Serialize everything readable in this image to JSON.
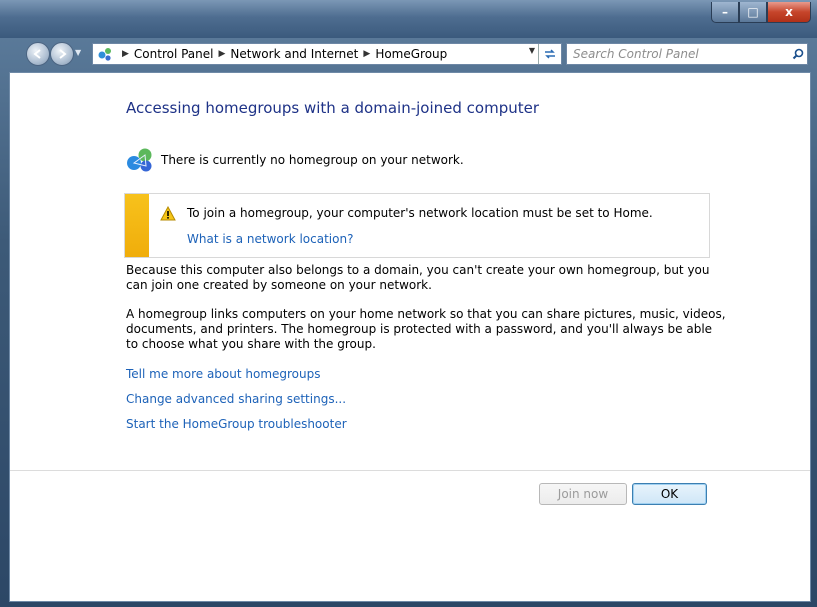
{
  "titlebar": {
    "minimize": "–",
    "maximize": "□",
    "close": "x"
  },
  "navbar": {
    "breadcrumbs": [
      "Control Panel",
      "Network and Internet",
      "HomeGroup"
    ],
    "search_placeholder": "Search Control Panel"
  },
  "main": {
    "heading": "Accessing homegroups with a domain-joined computer",
    "status_text": "There is currently no homegroup on your network.",
    "warning": {
      "text": "To join a homegroup, your computer's network location must be set to Home.",
      "link": "What is a network location?"
    },
    "paragraph1": "Because this computer also belongs to a domain, you can't create your own homegroup, but you can join one created by someone on your network.",
    "paragraph2": "A homegroup links computers on your home network so that you can share pictures, music, videos, documents, and printers. The homegroup is protected with a password, and you'll always be able to choose what you share with the group.",
    "links": [
      "Tell me more about homegroups",
      "Change advanced sharing settings...",
      "Start the HomeGroup troubleshooter"
    ]
  },
  "buttons": {
    "join_now": "Join now",
    "ok": "OK"
  },
  "colors": {
    "link": "#1d62b8",
    "heading": "#1e3287",
    "warning_stripe": "#f7c21c"
  }
}
